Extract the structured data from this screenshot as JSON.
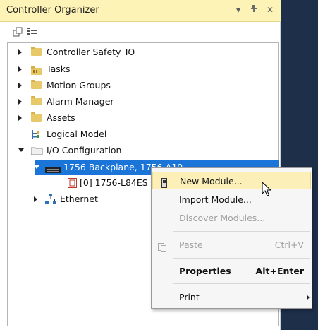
{
  "window": {
    "title": "Controller Organizer",
    "buttons": {
      "dropdown": "▾",
      "pin": "ᵩ",
      "close": "✕"
    }
  },
  "tree": {
    "items": [
      {
        "label": "Controller Safety_IO"
      },
      {
        "label": "Tasks"
      },
      {
        "label": "Motion Groups"
      },
      {
        "label": "Alarm Manager"
      },
      {
        "label": "Assets"
      },
      {
        "label": "Logical Model"
      },
      {
        "label": "I/O Configuration"
      },
      {
        "label": "1756 Backplane, 1756-A10"
      },
      {
        "label": "[0] 1756-L84ES"
      },
      {
        "label": "Ethernet"
      }
    ]
  },
  "context_menu": {
    "new_module": "New Module...",
    "import_module": "Import Module...",
    "discover_modules": "Discover Modules...",
    "paste": "Paste",
    "paste_shortcut": "Ctrl+V",
    "properties": "Properties",
    "properties_shortcut": "Alt+Enter",
    "print": "Print"
  },
  "colors": {
    "titlebar": "#fdf3b6",
    "selection": "#1b74d8",
    "menu_highlight": "#fcf0b8",
    "side_panel": "#1e2f4a"
  }
}
